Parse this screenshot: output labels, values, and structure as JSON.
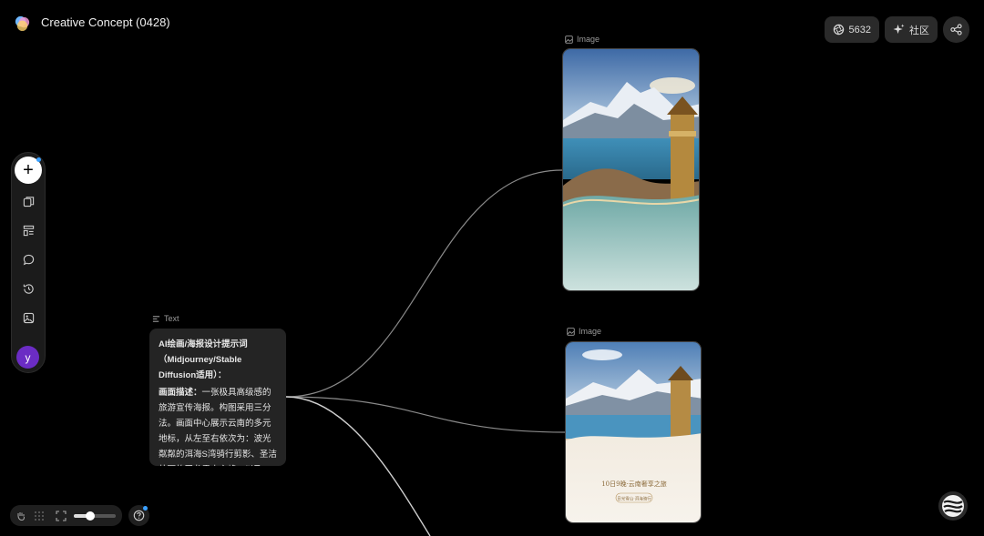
{
  "header": {
    "title": "Creative Concept (0428)"
  },
  "top_right": {
    "credits": "5632",
    "community_label": "社区"
  },
  "sidebar": {
    "avatar_letter": "y"
  },
  "text_node": {
    "type_label": "Text",
    "title": "AI绘画/海报设计提示词（Midjourney/Stable Diffusion适用）：",
    "desc_label": "画面描述：",
    "desc": "一张极具高级感的旅游宣传海报。构图采用三分法。画面中心展示云南的多元地标，从左至右依次为：波光粼粼的洱海S湾骑行剪影、圣洁壮丽的玉龙雪山主峰，以及"
  },
  "image_node_1": {
    "type_label": "Image"
  },
  "image_node_2": {
    "type_label": "Image",
    "poster_title": "10日9晚·云南奢享之旅",
    "poster_sub": "日光雪山·洱海骑行"
  },
  "colors": {
    "accent": "#3aa0ff",
    "avatar": "#6b2cc4"
  }
}
